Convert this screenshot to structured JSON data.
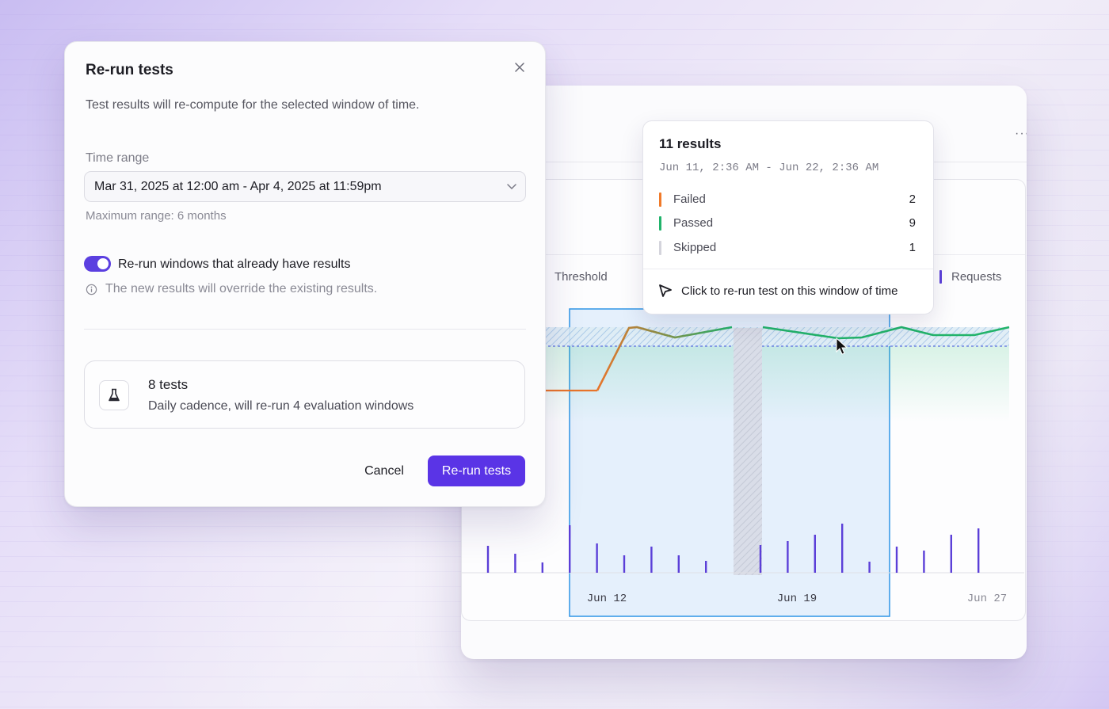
{
  "modal": {
    "title": "Re-run tests",
    "description": "Test results will re-compute for the selected window of time.",
    "time_range_label": "Time range",
    "time_range_value": "Mar 31, 2025 at 12:00 am - Apr 4, 2025 at 11:59pm",
    "time_range_hint": "Maximum range: 6 months",
    "toggle_label": "Re-run windows that already have results",
    "toggle_on": true,
    "info_text": "The new results will override the existing results.",
    "card_title": "8 tests",
    "card_subtitle": "Daily cadence, will re-run 4 evaluation windows",
    "cancel_label": "Cancel",
    "primary_label": "Re-run tests"
  },
  "panel": {
    "more_label": "···",
    "legend_threshold": "Threshold",
    "legend_requests": "Requests"
  },
  "tooltip": {
    "title": "11 results",
    "range": "Jun 11, 2:36 AM - Jun 22, 2:36 AM",
    "rows": [
      {
        "label": "Failed",
        "value": "2",
        "color": "#f07a2a"
      },
      {
        "label": "Passed",
        "value": "9",
        "color": "#21b36b"
      },
      {
        "label": "Skipped",
        "value": "1",
        "color": "#d4d4dc"
      }
    ],
    "action": "Click to re-run test on this window of time"
  },
  "colors": {
    "accent": "#5a34e6",
    "requests": "#5b3fd8",
    "passed": "#21b36b",
    "failed": "#f07a2a",
    "selection": "#2f95e6"
  },
  "chart_data": {
    "type": "line",
    "x_ticks": [
      "Jun 12",
      "Jun 19",
      "Jun 27"
    ],
    "series": [
      {
        "name": "Requests",
        "values": [
          34,
          24,
          13,
          60,
          37,
          22,
          33,
          22,
          15,
          0,
          35,
          40,
          48,
          62,
          14,
          33,
          28,
          48,
          56
        ]
      }
    ]
  }
}
